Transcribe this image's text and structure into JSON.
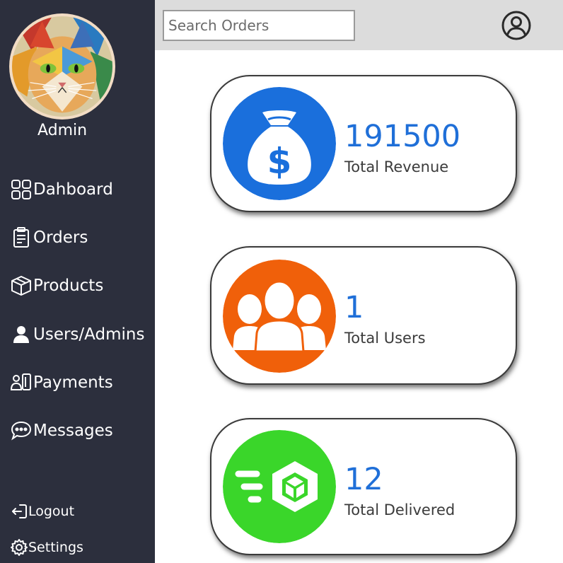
{
  "sidebar": {
    "user_name": "Admin",
    "nav": [
      {
        "label": "Dahboard",
        "icon": "grid-icon"
      },
      {
        "label": "Orders",
        "icon": "clipboard-icon"
      },
      {
        "label": "Products",
        "icon": "box-icon"
      },
      {
        "label": "Users/Admins",
        "icon": "user-icon"
      },
      {
        "label": "Payments",
        "icon": "payments-icon"
      },
      {
        "label": "Messages",
        "icon": "chat-icon"
      }
    ],
    "footer": [
      {
        "label": "Logout",
        "icon": "logout-icon"
      },
      {
        "label": "Settings",
        "icon": "gear-icon"
      }
    ]
  },
  "header": {
    "search_placeholder": "Search Orders",
    "account_icon": "user-circle-icon"
  },
  "stats": [
    {
      "value": "191500",
      "label": "Total Revenue",
      "icon": "money-bag-icon",
      "color": "#1a6fdc"
    },
    {
      "value": "1",
      "label": "Total Users",
      "icon": "users-group-icon",
      "color": "#f0600a"
    },
    {
      "value": "12",
      "label": "Total Delivered",
      "icon": "delivery-box-icon",
      "color": "#3ad62a"
    }
  ],
  "colors": {
    "sidebar_bg": "#2c2f3d",
    "topbar_bg": "#dcdcdc",
    "value_text": "#1f6fd8"
  }
}
